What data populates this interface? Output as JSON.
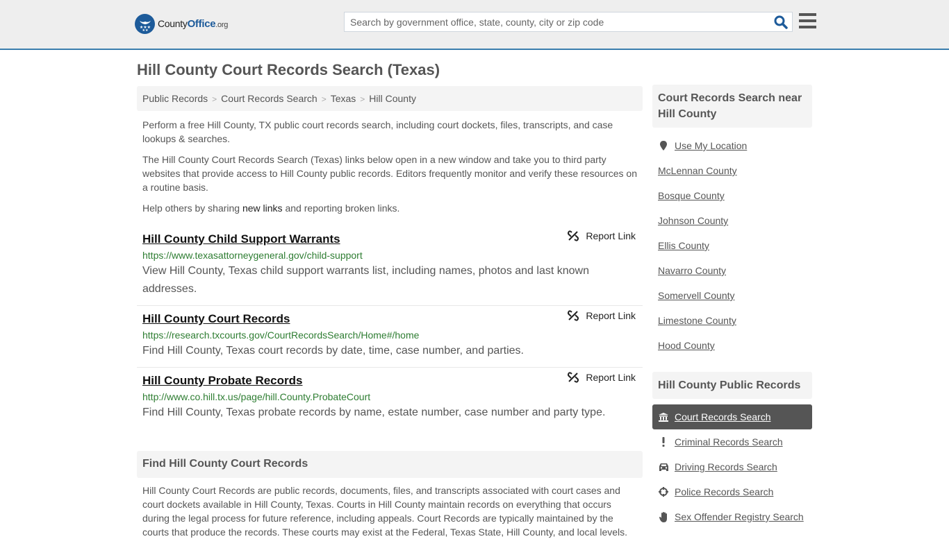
{
  "header": {
    "logo": {
      "name": "County",
      "name_bold": "Office",
      "tld": ".org",
      "icon": "eagle-stars-badge-icon"
    },
    "search": {
      "placeholder": "Search by government office, state, county, city or zip code",
      "value": "",
      "icon": "search-icon"
    },
    "menu_icon": "hamburger-menu-icon",
    "colors": {
      "brand": "#1d5b9a",
      "accent_line": "#3a7dad"
    }
  },
  "page": {
    "title": "Hill County Court Records Search (Texas)",
    "breadcrumb": [
      "Public Records",
      "Court Records Search",
      "Texas",
      "Hill County"
    ],
    "breadcrumb_separator": ">",
    "intro": [
      "Perform a free Hill County, TX public court records search, including court dockets, files, transcripts, and case lookups & searches.",
      "The Hill County Court Records Search (Texas) links below open in a new window and take you to third party websites that provide access to Hill County public records. Editors frequently monitor and verify these resources on a routine basis."
    ],
    "help": {
      "before": "Help others by sharing ",
      "link": "new links",
      "after": " and reporting broken links."
    },
    "links": [
      {
        "title": "Hill County Child Support Warrants",
        "url": "https://www.texasattorneygeneral.gov/child-support",
        "description": "View Hill County, Texas child support warrants list, including names, photos and last known addresses.",
        "report_label": "Report Link"
      },
      {
        "title": "Hill County Court Records",
        "url": "https://research.txcourts.gov/CourtRecordsSearch/Home#/home",
        "description": "Find Hill County, Texas court records by date, time, case number, and parties.",
        "report_label": "Report Link"
      },
      {
        "title": "Hill County Probate Records",
        "url": "http://www.co.hill.tx.us/page/hill.County.ProbateCourt",
        "description": "Find Hill County, Texas probate records by name, estate number, case number and party type.",
        "report_label": "Report Link"
      }
    ],
    "find_section": {
      "heading": "Find Hill County Court Records",
      "text": "Hill County Court Records are public records, documents, files, and transcripts associated with court cases and court dockets available in Hill County, Texas. Courts in Hill County maintain records on everything that occurs during the legal process for future reference, including appeals. Court Records are typically maintained by the courts that produce the records. These courts may exist at the Federal, Texas State, Hill County, and local levels."
    }
  },
  "sidebar": {
    "nearby": {
      "heading": "Court Records Search near Hill County",
      "use_location": "Use My Location",
      "counties": [
        "McLennan County",
        "Bosque County",
        "Johnson County",
        "Ellis County",
        "Navarro County",
        "Somervell County",
        "Limestone County",
        "Hood County"
      ]
    },
    "public_records": {
      "heading": "Hill County Public Records",
      "items": [
        {
          "label": "Court Records Search",
          "icon": "courthouse-icon",
          "active": true
        },
        {
          "label": "Criminal Records Search",
          "icon": "exclamation-icon",
          "active": false
        },
        {
          "label": "Driving Records Search",
          "icon": "car-icon",
          "active": false
        },
        {
          "label": "Police Records Search",
          "icon": "crosshairs-icon",
          "active": false
        },
        {
          "label": "Sex Offender Registry Search",
          "icon": "hand-icon",
          "active": false
        }
      ]
    }
  }
}
